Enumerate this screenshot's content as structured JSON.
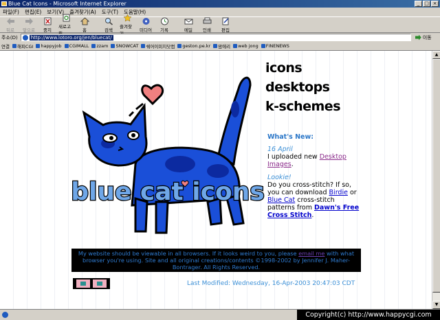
{
  "window": {
    "title": "Blue Cat Icons - Microsoft Internet Explorer",
    "controls": [
      "_",
      "□",
      "×"
    ]
  },
  "menu": [
    "파일(F)",
    "편집(E)",
    "보기(V)",
    "즐겨찾기(A)",
    "도구(T)",
    "도움말(H)"
  ],
  "toolbar": {
    "back": "뒤로",
    "forward": "앞으로",
    "stop": "중지",
    "refresh": "새로고침",
    "home": "홈",
    "search": "검색",
    "favorites": "즐겨찾기",
    "media": "미디어",
    "history": "기록",
    "mail": "메일",
    "print": "인쇄",
    "edit": "편집"
  },
  "address": {
    "label": "주소(D)",
    "url": "http://www.lotoro.org/jen/bluecat/",
    "go": "이동"
  },
  "links": {
    "label": "연결",
    "items": [
      "해피CGI",
      "happyjob",
      "CGIMALL",
      "zzam",
      "SNOWCAT",
      "쉐어이미지닷컴",
      "geston.pe.kr",
      "맘에리",
      "web jong",
      "FINENEWS"
    ]
  },
  "page": {
    "logo_text": "blue cat icons",
    "nav": [
      "icons",
      "desktops",
      "k-schemes"
    ],
    "whats_new": {
      "heading": "What's New:",
      "entry1_date": "16 April",
      "entry1_text": "I uploaded new ",
      "entry1_link": "Desktop Images",
      "entry1_end": ".",
      "entry2_date": "Lookie!",
      "entry2_text1": "Do you cross-stitch? If so, you can download ",
      "entry2_link1": "Birdie",
      "entry2_text2": " or ",
      "entry2_link2": "Blue Cat",
      "entry2_text3": " cross-stitch patterns from ",
      "entry2_link3": "Dawn's Free Cross Stitch",
      "entry2_end": "."
    },
    "notice": {
      "line1a": "My website should be viewable in all browsers. If it looks weird to you, please ",
      "email": "email me",
      "line1b": " with what browser you're using. Site and all original creations/contents ©1998-2002 by Jennifer J. Maher-Bontrager. All Rights Reserved."
    },
    "last_modified": "Last Modified: Wednesday, 16-Apr-2003 20:47:03 CDT"
  },
  "copyright": "Copyright(c) http://www.happycgi.com",
  "colors": {
    "cat_blue": "#1a4fd8",
    "cat_dark": "#0c2aa0",
    "heart": "#f08080",
    "accent_blue": "#3b8fd6"
  }
}
